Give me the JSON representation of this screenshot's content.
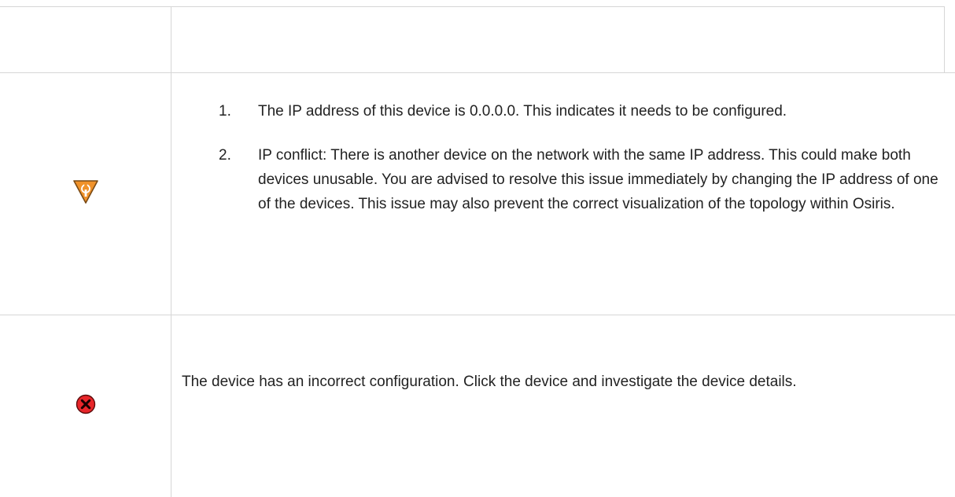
{
  "table": {
    "rows": [
      {
        "icon": "",
        "text": ""
      },
      {
        "icon": "warning-wrench-icon",
        "icon_color": "#F0922A",
        "items": [
          {
            "number": "1.",
            "text": "The IP address of this device is 0.0.0.0. This indicates it needs to be configured."
          },
          {
            "number": "2.",
            "text": "IP conflict: There is another device on the network with the same IP address. This could make both devices unusable. You are advised to resolve this issue immediately by changing the IP address of one of the devices. This issue may also prevent the correct visualization of the topology within Osiris."
          }
        ]
      },
      {
        "icon": "error-x-icon",
        "icon_color": "#E8262A",
        "text": "The device has an incorrect configuration. Click the device and investigate the device details."
      }
    ]
  }
}
